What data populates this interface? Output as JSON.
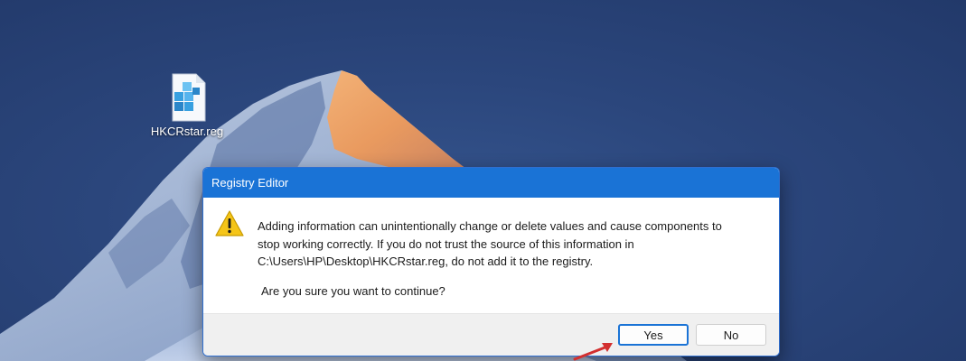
{
  "desktop": {
    "icon": {
      "label": "HKCRstar.reg",
      "icon_name": "registry-file-icon"
    }
  },
  "dialog": {
    "title": "Registry Editor",
    "icon_name": "warning-icon",
    "message_lines": [
      "Adding information can unintentionally change or delete values and cause components to",
      "stop working correctly. If you do not trust the source of this information in",
      "C:\\Users\\HP\\Desktop\\HKCRstar.reg, do not add it to the registry."
    ],
    "question": "Are you sure you want to continue?",
    "buttons": {
      "yes": "Yes",
      "no": "No"
    }
  },
  "colors": {
    "titlebar": "#1a73d6",
    "accent_arrow": "#d32f2f",
    "warning_fill": "#f5c518"
  }
}
